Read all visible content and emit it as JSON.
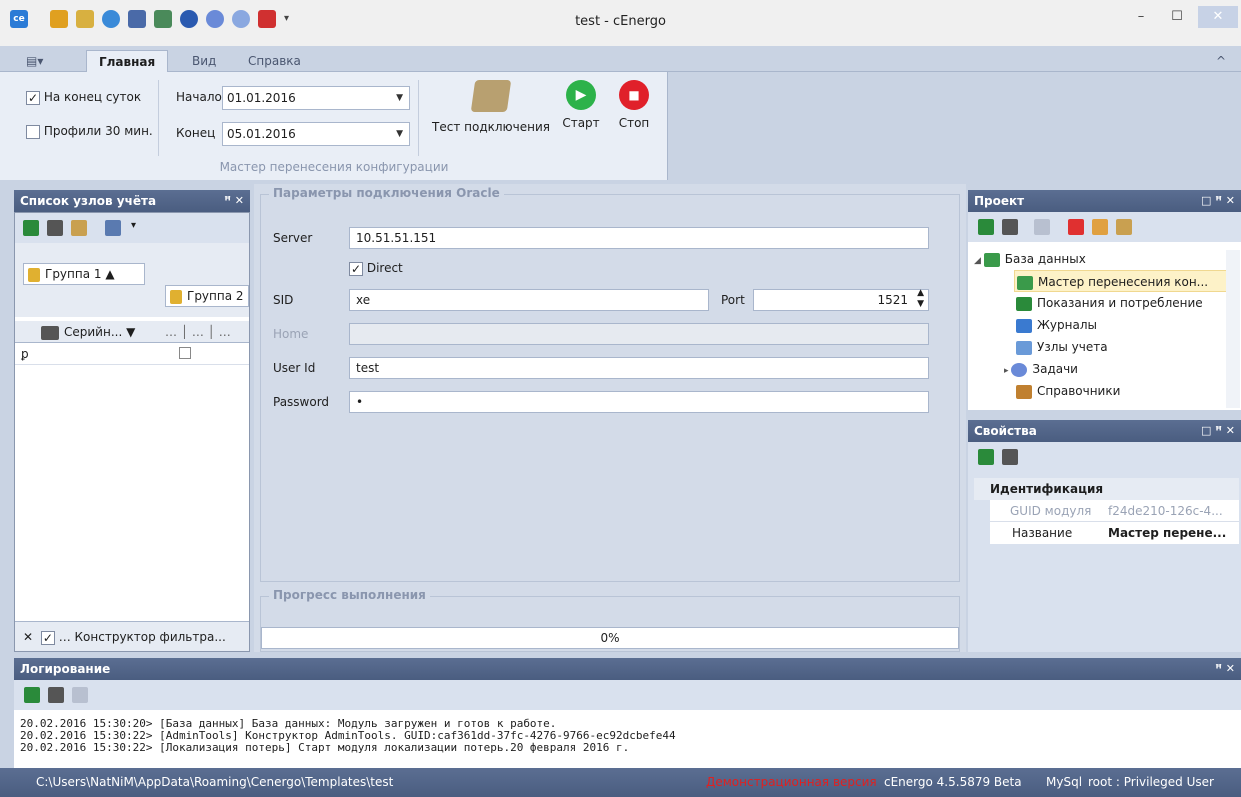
{
  "window": {
    "title": "test - cEnergo",
    "min": "–",
    "max": "☐",
    "close": "✕"
  },
  "ribbon": {
    "tabs": [
      "Главная",
      "Вид",
      "Справка"
    ],
    "menu_icon": "▤▾",
    "collapse": "^",
    "end_of_day_label": "На конец суток",
    "profiles_label": "Профили 30 мин.",
    "start_label": "Начало",
    "start_value": "01.01.2016",
    "end_label": "Конец",
    "end_value": "05.01.2016",
    "test_conn_label": "Тест подключения",
    "start_btn_label": "Старт",
    "stop_btn_label": "Стоп",
    "group_caption": "Мастер перенесения конфигурации"
  },
  "left_panel": {
    "title": "Список узлов учёта",
    "pin": "ꟸ ✕",
    "group1": "Группа 1",
    "group2": "Группа 2",
    "col_serial": "Серийн...",
    "col_dots": "… │ … │ …",
    "filter_label": "… Конструктор фильтра..."
  },
  "oracle": {
    "legend": "Параметры подключения Oracle",
    "server_label": "Server",
    "server_value": "10.51.51.151",
    "direct_label": "Direct",
    "sid_label": "SID",
    "sid_value": "xe",
    "port_label": "Port",
    "port_value": "1521",
    "home_label": "Home",
    "user_label": "User Id",
    "user_value": "test",
    "password_label": "Password",
    "password_value": "•"
  },
  "progress": {
    "legend": "Прогресс выполнения",
    "value": 0,
    "text": "0%"
  },
  "project": {
    "title": "Проект",
    "items": [
      "База данных",
      "Мастер перенесения кон...",
      "Показания и потребление",
      "Журналы",
      "Узлы учета",
      "Задачи",
      "Справочники"
    ]
  },
  "properties": {
    "title": "Свойства",
    "category": "Идентификация",
    "rows": [
      {
        "key": "GUID модуля",
        "value": "f24de210-126c-4..."
      },
      {
        "key": "Название",
        "value": "Мастер перене..."
      }
    ]
  },
  "log": {
    "title": "Логирование",
    "lines": [
      "20.02.2016 15:30:20> [База данных] База данных: Модуль загружен и готов к работе.",
      "20.02.2016 15:30:22> [AdminTools] Конструктор AdminTools. GUID:caf361dd-37fc-4276-9766-ec92dcbefe44",
      "20.02.2016 15:30:22> [Локализация потерь] Старт модуля локализации потерь.20 февраля 2016 г."
    ]
  },
  "status": {
    "path": "C:\\Users\\NatNiM\\AppData\\Roaming\\Cenergo\\Templates\\test",
    "demo": "Демонстрационная версия",
    "version": "cEnergo 4.5.5879 Beta",
    "db": "MySql",
    "user": "root : Privileged User"
  },
  "colors": {
    "accent": "#4a5d80",
    "demo": "#e02020",
    "green": "#2db24a",
    "red": "#e0202a"
  }
}
